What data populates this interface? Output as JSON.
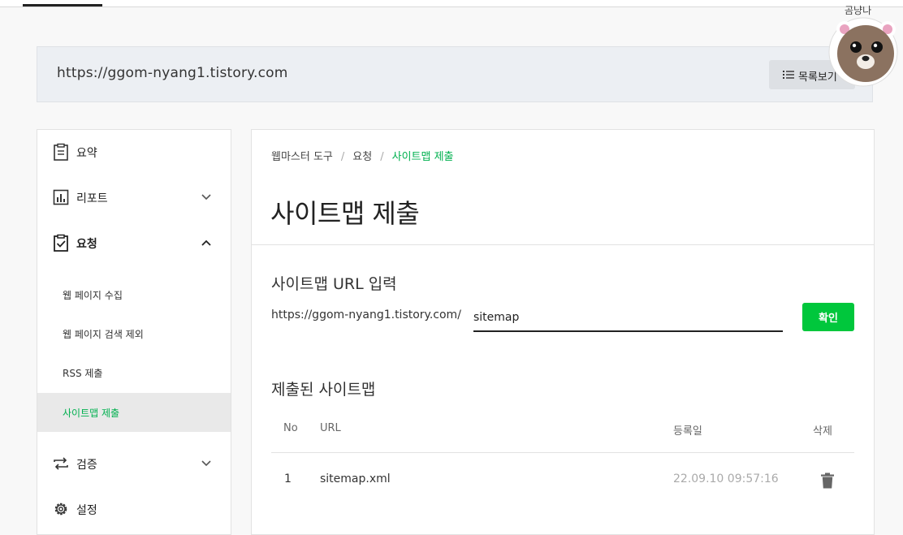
{
  "site": {
    "url": "https://ggom-nyang1.tistory.com",
    "list_button": "목록보기"
  },
  "mascot": {
    "label": "곰냥나"
  },
  "sidebar": {
    "items": [
      {
        "label": "요약",
        "icon": "clipboard-icon"
      },
      {
        "label": "리포트",
        "icon": "bar-chart-icon"
      },
      {
        "label": "요청",
        "icon": "check-clipboard-icon"
      },
      {
        "label": "검증",
        "icon": "repeat-icon"
      },
      {
        "label": "설정",
        "icon": "gear-icon"
      }
    ],
    "sub_items": [
      {
        "label": "웹 페이지 수집"
      },
      {
        "label": "웹 페이지 검색 제외"
      },
      {
        "label": "RSS 제출"
      },
      {
        "label": "사이트맵 제출"
      }
    ]
  },
  "breadcrumb": {
    "root": "웹마스터 도구",
    "mid": "요청",
    "current": "사이트맵 제출",
    "sep": "/"
  },
  "main": {
    "title": "사이트맵 제출",
    "url_section": {
      "title": "사이트맵 URL 입력",
      "prefix": "https://ggom-nyang1.tistory.com/",
      "value": "sitemap",
      "confirm": "확인"
    },
    "submitted": {
      "title": "제출된 사이트맵",
      "columns": [
        "No",
        "URL",
        "등록일",
        "삭제"
      ],
      "rows": [
        {
          "no": "1",
          "url": "sitemap.xml",
          "date": "22.09.10 09:57:16"
        }
      ]
    }
  },
  "colors": {
    "accent": "#00c73c",
    "active_text": "#00b04f"
  }
}
